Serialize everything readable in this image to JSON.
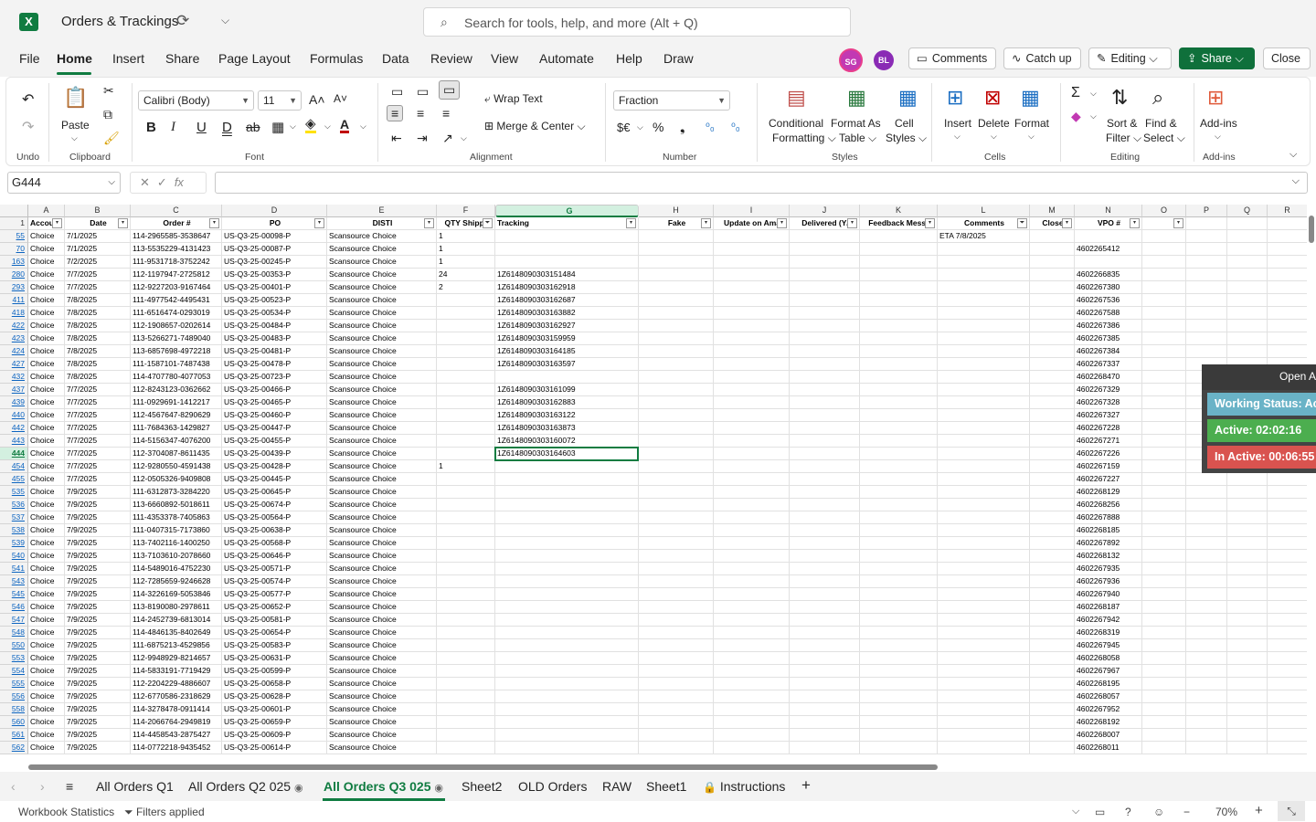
{
  "title": {
    "doc": "Orders & Trackings",
    "search_placeholder": "Search for tools, help, and more (Alt + Q)"
  },
  "menu": {
    "tabs": [
      "File",
      "Home",
      "Insert",
      "Share",
      "Page Layout",
      "Formulas",
      "Data",
      "Review",
      "View",
      "Automate",
      "Help",
      "Draw"
    ],
    "avatars": [
      {
        "initials": "SG",
        "color": "#c239b3"
      },
      {
        "initials": "BL",
        "color": "#8a2bb5"
      }
    ],
    "comments": "Comments",
    "catchup": "Catch up",
    "editing": "Editing",
    "share": "Share",
    "close": "Close"
  },
  "ribbon": {
    "undo_group": "Undo",
    "clipboard": {
      "paste": "Paste",
      "label": "Clipboard"
    },
    "font": {
      "name": "Calibri (Body)",
      "size": "11",
      "label": "Font"
    },
    "alignment": {
      "wrap": "Wrap Text",
      "merge": "Merge & Center",
      "label": "Alignment"
    },
    "number": {
      "format": "Fraction",
      "label": "Number"
    },
    "styles": {
      "cond1": "Conditional",
      "cond2": "Formatting",
      "fmt1": "Format As",
      "fmt2": "Table",
      "cell1": "Cell",
      "cell2": "Styles",
      "label": "Styles"
    },
    "cells": {
      "insert": "Insert",
      "delete": "Delete",
      "format": "Format",
      "label": "Cells"
    },
    "editing": {
      "sort1": "Sort &",
      "sort2": "Filter",
      "find1": "Find &",
      "find2": "Select",
      "label": "Editing"
    },
    "addins": {
      "btn": "Add-ins",
      "label": "Add-ins"
    }
  },
  "formula_bar": {
    "name_box": "G444",
    "fx": "fx",
    "formula": ""
  },
  "columns": [
    {
      "letter": "A",
      "header": "Accou"
    },
    {
      "letter": "B",
      "header": "Date"
    },
    {
      "letter": "C",
      "header": "Order #"
    },
    {
      "letter": "D",
      "header": "PO"
    },
    {
      "letter": "E",
      "header": "DISTI"
    },
    {
      "letter": "F",
      "header": "QTY Shippe"
    },
    {
      "letter": "G",
      "header": "Tracking"
    },
    {
      "letter": "H",
      "header": "Fake"
    },
    {
      "letter": "I",
      "header": "Update on Ama"
    },
    {
      "letter": "J",
      "header": "Delivered (Y/"
    },
    {
      "letter": "K",
      "header": "Feedback Messa"
    },
    {
      "letter": "L",
      "header": "Comments"
    },
    {
      "letter": "M",
      "header": "Close"
    },
    {
      "letter": "N",
      "header": "VPO #"
    },
    {
      "letter": "O",
      "header": ""
    },
    {
      "letter": "P",
      "header": ""
    },
    {
      "letter": "Q",
      "header": ""
    },
    {
      "letter": "R",
      "header": ""
    }
  ],
  "header_row_num": "1",
  "rows": [
    {
      "n": "55",
      "a": "Choice",
      "b": "7/1/2025",
      "c": "114-2965585-3538647",
      "d": "US-Q3-25-00098-P",
      "e": "Scansource Choice",
      "f": "1",
      "g": "",
      "l": "ETA 7/8/2025",
      "vpo": ""
    },
    {
      "n": "70",
      "a": "Choice",
      "b": "7/1/2025",
      "c": "113-5535229-4131423",
      "d": "US-Q3-25-00087-P",
      "e": "Scansource Choice",
      "f": "1",
      "g": "",
      "l": "",
      "vpo": "4602265412"
    },
    {
      "n": "163",
      "a": "Choice",
      "b": "7/2/2025",
      "c": "111-9531718-3752242",
      "d": "US-Q3-25-00245-P",
      "e": "Scansource Choice",
      "f": "1",
      "g": "",
      "l": "",
      "vpo": ""
    },
    {
      "n": "280",
      "a": "Choice",
      "b": "7/7/2025",
      "c": "112-1197947-2725812",
      "d": "US-Q3-25-00353-P",
      "e": "Scansource Choice",
      "f": "24",
      "g": "1Z6148090303151484",
      "l": "",
      "vpo": "4602266835"
    },
    {
      "n": "293",
      "a": "Choice",
      "b": "7/7/2025",
      "c": "112-9227203-9167464",
      "d": "US-Q3-25-00401-P",
      "e": "Scansource Choice",
      "f": "2",
      "g": "1Z6148090303162918",
      "l": "",
      "vpo": "4602267380"
    },
    {
      "n": "411",
      "a": "Choice",
      "b": "7/8/2025",
      "c": "111-4977542-4495431",
      "d": "US-Q3-25-00523-P",
      "e": "Scansource Choice",
      "f": "",
      "g": "1Z6148090303162687",
      "l": "",
      "vpo": "4602267536"
    },
    {
      "n": "418",
      "a": "Choice",
      "b": "7/8/2025",
      "c": "111-6516474-0293019",
      "d": "US-Q3-25-00534-P",
      "e": "Scansource Choice",
      "f": "",
      "g": "1Z6148090303163882",
      "l": "",
      "vpo": "4602267588"
    },
    {
      "n": "422",
      "a": "Choice",
      "b": "7/8/2025",
      "c": "112-1908657-0202614",
      "d": "US-Q3-25-00484-P",
      "e": "Scansource Choice",
      "f": "",
      "g": "1Z6148090303162927",
      "l": "",
      "vpo": "4602267386"
    },
    {
      "n": "423",
      "a": "Choice",
      "b": "7/8/2025",
      "c": "113-5266271-7489040",
      "d": "US-Q3-25-00483-P",
      "e": "Scansource Choice",
      "f": "",
      "g": "1Z6148090303159959",
      "l": "",
      "vpo": "4602267385"
    },
    {
      "n": "424",
      "a": "Choice",
      "b": "7/8/2025",
      "c": "113-6857698-4972218",
      "d": "US-Q3-25-00481-P",
      "e": "Scansource Choice",
      "f": "",
      "g": "1Z6148090303164185",
      "l": "",
      "vpo": "4602267384"
    },
    {
      "n": "427",
      "a": "Choice",
      "b": "7/8/2025",
      "c": "111-1587101-7487438",
      "d": "US-Q3-25-00478-P",
      "e": "Scansource Choice",
      "f": "",
      "g": "1Z6148090303163597",
      "l": "",
      "vpo": "4602267337"
    },
    {
      "n": "432",
      "a": "Choice",
      "b": "7/8/2025",
      "c": "114-4707780-4077053",
      "d": "US-Q3-25-00723-P",
      "e": "Scansource Choice",
      "f": "",
      "g": "",
      "l": "",
      "vpo": "4602268470"
    },
    {
      "n": "437",
      "a": "Choice",
      "b": "7/7/2025",
      "c": "112-8243123-0362662",
      "d": "US-Q3-25-00466-P",
      "e": "Scansource Choice",
      "f": "",
      "g": "1Z6148090303161099",
      "l": "",
      "vpo": "4602267329"
    },
    {
      "n": "439",
      "a": "Choice",
      "b": "7/7/2025",
      "c": "111-0929691-1412217",
      "d": "US-Q3-25-00465-P",
      "e": "Scansource Choice",
      "f": "",
      "g": "1Z6148090303162883",
      "l": "",
      "vpo": "4602267328"
    },
    {
      "n": "440",
      "a": "Choice",
      "b": "7/7/2025",
      "c": "112-4567647-8290629",
      "d": "US-Q3-25-00460-P",
      "e": "Scansource Choice",
      "f": "",
      "g": "1Z6148090303163122",
      "l": "",
      "vpo": "4602267327"
    },
    {
      "n": "442",
      "a": "Choice",
      "b": "7/7/2025",
      "c": "111-7684363-1429827",
      "d": "US-Q3-25-00447-P",
      "e": "Scansource Choice",
      "f": "",
      "g": "1Z6148090303163873",
      "l": "",
      "vpo": "4602267228"
    },
    {
      "n": "443",
      "a": "Choice",
      "b": "7/7/2025",
      "c": "114-5156347-4076200",
      "d": "US-Q3-25-00455-P",
      "e": "Scansource Choice",
      "f": "",
      "g": "1Z6148090303160072",
      "l": "",
      "vpo": "4602267271"
    },
    {
      "n": "444",
      "a": "Choice",
      "b": "7/7/2025",
      "c": "112-3704087-8611435",
      "d": "US-Q3-25-00439-P",
      "e": "Scansource Choice",
      "f": "",
      "g": "1Z6148090303164603",
      "l": "",
      "vpo": "4602267226"
    },
    {
      "n": "454",
      "a": "Choice",
      "b": "7/7/2025",
      "c": "112-9280550-4591438",
      "d": "US-Q3-25-00428-P",
      "e": "Scansource Choice",
      "f": "1",
      "g": "",
      "l": "",
      "vpo": "4602267159"
    },
    {
      "n": "455",
      "a": "Choice",
      "b": "7/7/2025",
      "c": "112-0505326-9409808",
      "d": "US-Q3-25-00445-P",
      "e": "Scansource Choice",
      "f": "",
      "g": "",
      "l": "",
      "vpo": "4602267227"
    },
    {
      "n": "535",
      "a": "Choice",
      "b": "7/9/2025",
      "c": "111-6312873-3284220",
      "d": "US-Q3-25-00645-P",
      "e": "Scansource Choice",
      "f": "",
      "g": "",
      "l": "",
      "vpo": "4602268129"
    },
    {
      "n": "536",
      "a": "Choice",
      "b": "7/9/2025",
      "c": "113-6660892-5018611",
      "d": "US-Q3-25-00674-P",
      "e": "Scansource Choice",
      "f": "",
      "g": "",
      "l": "",
      "vpo": "4602268256"
    },
    {
      "n": "537",
      "a": "Choice",
      "b": "7/9/2025",
      "c": "111-4353378-7405863",
      "d": "US-Q3-25-00564-P",
      "e": "Scansource Choice",
      "f": "",
      "g": "",
      "l": "",
      "vpo": "4602267888"
    },
    {
      "n": "538",
      "a": "Choice",
      "b": "7/9/2025",
      "c": "111-0407315-7173860",
      "d": "US-Q3-25-00638-P",
      "e": "Scansource Choice",
      "f": "",
      "g": "",
      "l": "",
      "vpo": "4602268185"
    },
    {
      "n": "539",
      "a": "Choice",
      "b": "7/9/2025",
      "c": "113-7402116-1400250",
      "d": "US-Q3-25-00568-P",
      "e": "Scansource Choice",
      "f": "",
      "g": "",
      "l": "",
      "vpo": "4602267892"
    },
    {
      "n": "540",
      "a": "Choice",
      "b": "7/9/2025",
      "c": "113-7103610-2078660",
      "d": "US-Q3-25-00646-P",
      "e": "Scansource Choice",
      "f": "",
      "g": "",
      "l": "",
      "vpo": "4602268132"
    },
    {
      "n": "541",
      "a": "Choice",
      "b": "7/9/2025",
      "c": "114-5489016-4752230",
      "d": "US-Q3-25-00571-P",
      "e": "Scansource Choice",
      "f": "",
      "g": "",
      "l": "",
      "vpo": "4602267935"
    },
    {
      "n": "543",
      "a": "Choice",
      "b": "7/9/2025",
      "c": "112-7285659-9246628",
      "d": "US-Q3-25-00574-P",
      "e": "Scansource Choice",
      "f": "",
      "g": "",
      "l": "",
      "vpo": "4602267936"
    },
    {
      "n": "545",
      "a": "Choice",
      "b": "7/9/2025",
      "c": "114-3226169-5053846",
      "d": "US-Q3-25-00577-P",
      "e": "Scansource Choice",
      "f": "",
      "g": "",
      "l": "",
      "vpo": "4602267940"
    },
    {
      "n": "546",
      "a": "Choice",
      "b": "7/9/2025",
      "c": "113-8190080-2978611",
      "d": "US-Q3-25-00652-P",
      "e": "Scansource Choice",
      "f": "",
      "g": "",
      "l": "",
      "vpo": "4602268187"
    },
    {
      "n": "547",
      "a": "Choice",
      "b": "7/9/2025",
      "c": "114-2452739-6813014",
      "d": "US-Q3-25-00581-P",
      "e": "Scansource Choice",
      "f": "",
      "g": "",
      "l": "",
      "vpo": "4602267942"
    },
    {
      "n": "548",
      "a": "Choice",
      "b": "7/9/2025",
      "c": "114-4846135-8402649",
      "d": "US-Q3-25-00654-P",
      "e": "Scansource Choice",
      "f": "",
      "g": "",
      "l": "",
      "vpo": "4602268319"
    },
    {
      "n": "550",
      "a": "Choice",
      "b": "7/9/2025",
      "c": "111-6875213-4529856",
      "d": "US-Q3-25-00583-P",
      "e": "Scansource Choice",
      "f": "",
      "g": "",
      "l": "",
      "vpo": "4602267945"
    },
    {
      "n": "553",
      "a": "Choice",
      "b": "7/9/2025",
      "c": "112-9948929-8214657",
      "d": "US-Q3-25-00631-P",
      "e": "Scansource Choice",
      "f": "",
      "g": "",
      "l": "",
      "vpo": "4602268058"
    },
    {
      "n": "554",
      "a": "Choice",
      "b": "7/9/2025",
      "c": "114-5833191-7719429",
      "d": "US-Q3-25-00599-P",
      "e": "Scansource Choice",
      "f": "",
      "g": "",
      "l": "",
      "vpo": "4602267967"
    },
    {
      "n": "555",
      "a": "Choice",
      "b": "7/9/2025",
      "c": "112-2204229-4886607",
      "d": "US-Q3-25-00658-P",
      "e": "Scansource Choice",
      "f": "",
      "g": "",
      "l": "",
      "vpo": "4602268195"
    },
    {
      "n": "556",
      "a": "Choice",
      "b": "7/9/2025",
      "c": "112-6770586-2318629",
      "d": "US-Q3-25-00628-P",
      "e": "Scansource Choice",
      "f": "",
      "g": "",
      "l": "",
      "vpo": "4602268057"
    },
    {
      "n": "558",
      "a": "Choice",
      "b": "7/9/2025",
      "c": "114-3278478-0911414",
      "d": "US-Q3-25-00601-P",
      "e": "Scansource Choice",
      "f": "",
      "g": "",
      "l": "",
      "vpo": "4602267952"
    },
    {
      "n": "560",
      "a": "Choice",
      "b": "7/9/2025",
      "c": "114-2066764-2949819",
      "d": "US-Q3-25-00659-P",
      "e": "Scansource Choice",
      "f": "",
      "g": "",
      "l": "",
      "vpo": "4602268192"
    },
    {
      "n": "561",
      "a": "Choice",
      "b": "7/9/2025",
      "c": "114-4458543-2875427",
      "d": "US-Q3-25-00609-P",
      "e": "Scansource Choice",
      "f": "",
      "g": "",
      "l": "",
      "vpo": "4602268007"
    },
    {
      "n": "562",
      "a": "Choice",
      "b": "7/9/2025",
      "c": "114-0772218-9435452",
      "d": "US-Q3-25-00614-P",
      "e": "Scansource Choice",
      "f": "",
      "g": "",
      "l": "",
      "vpo": "4602268011"
    }
  ],
  "panel": {
    "open": "Open A",
    "status": "Working Status: Acti",
    "active": "Active: 02:02:16",
    "inactive": "In Active: 00:06:55",
    "colors": {
      "status": "#6ab3c7",
      "active": "#4cae4f",
      "inactive": "#d9534f"
    }
  },
  "sheets": [
    {
      "name": "All Orders Q1",
      "icon": ""
    },
    {
      "name": "All Orders Q2 025",
      "icon": "eye"
    },
    {
      "name": "All Orders Q3 025",
      "icon": "eye",
      "active": true
    },
    {
      "name": "Sheet2",
      "icon": ""
    },
    {
      "name": "OLD Orders",
      "icon": ""
    },
    {
      "name": "RAW",
      "icon": ""
    },
    {
      "name": "Sheet1",
      "icon": ""
    },
    {
      "name": "Instructions",
      "icon": "lock"
    }
  ],
  "status": {
    "workbook_stats": "Workbook Statistics",
    "filters": "Filters applied",
    "zoom": "70%"
  },
  "accent": "#107c41"
}
